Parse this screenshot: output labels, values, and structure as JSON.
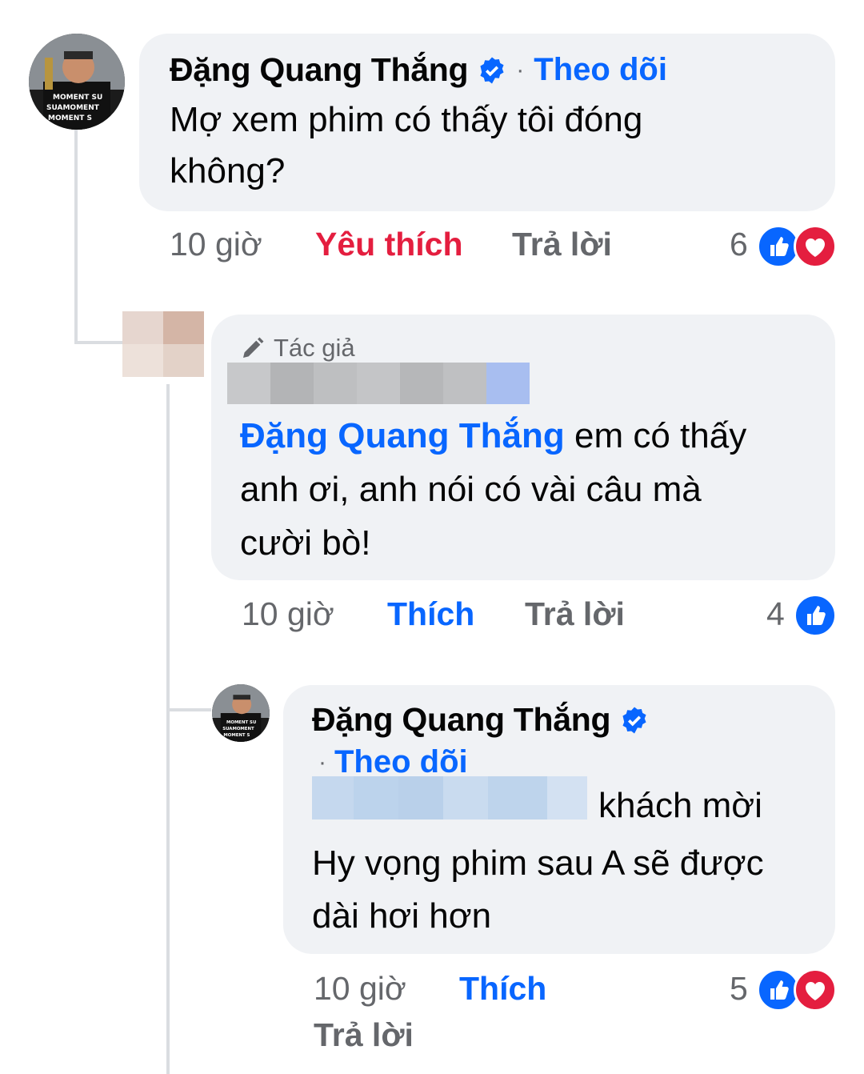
{
  "colors": {
    "accent": "#0866ff",
    "love": "#e41e3f",
    "meta_gray": "#65676b",
    "bubble_bg": "#f0f2f5"
  },
  "comment1": {
    "author": "Đặng Quang Thắng",
    "verified_icon": "verified-badge-icon",
    "separator": "·",
    "follow_label": "Theo dõi",
    "text_line1": "Mợ xem phim có thấy tôi đóng",
    "text_line2": "không?",
    "time": "10 giờ",
    "like_label": "Yêu thích",
    "reply_label": "Trả lời",
    "reaction_count": "6",
    "reactions": [
      "like-icon",
      "love-icon"
    ]
  },
  "reply1": {
    "author_badge": "Tác giả",
    "badge_icon": "pencil-icon",
    "mention": "Đặng Quang Thắng",
    "text_line1_rest": " em có thấy",
    "text_line2": "anh ơi, anh nói có vài câu mà",
    "text_line3": "cười bò!",
    "time": "10 giờ",
    "like_label": "Thích",
    "reply_label": "Trả lời",
    "reaction_count": "4",
    "reactions": [
      "like-icon"
    ]
  },
  "reply2": {
    "author": "Đặng Quang Thắng",
    "verified_icon": "verified-badge-icon",
    "separator": "·",
    "follow_label": "Theo dõi",
    "text_line1_rest": "khách mời",
    "text_line2": "Hy vọng phim sau A sẽ được",
    "text_line3": "dài hơi hơn",
    "time": "10 giờ",
    "like_label": "Thích",
    "reply_label": "Trả lời",
    "reaction_count": "5",
    "reactions": [
      "like-icon",
      "love-icon"
    ]
  }
}
